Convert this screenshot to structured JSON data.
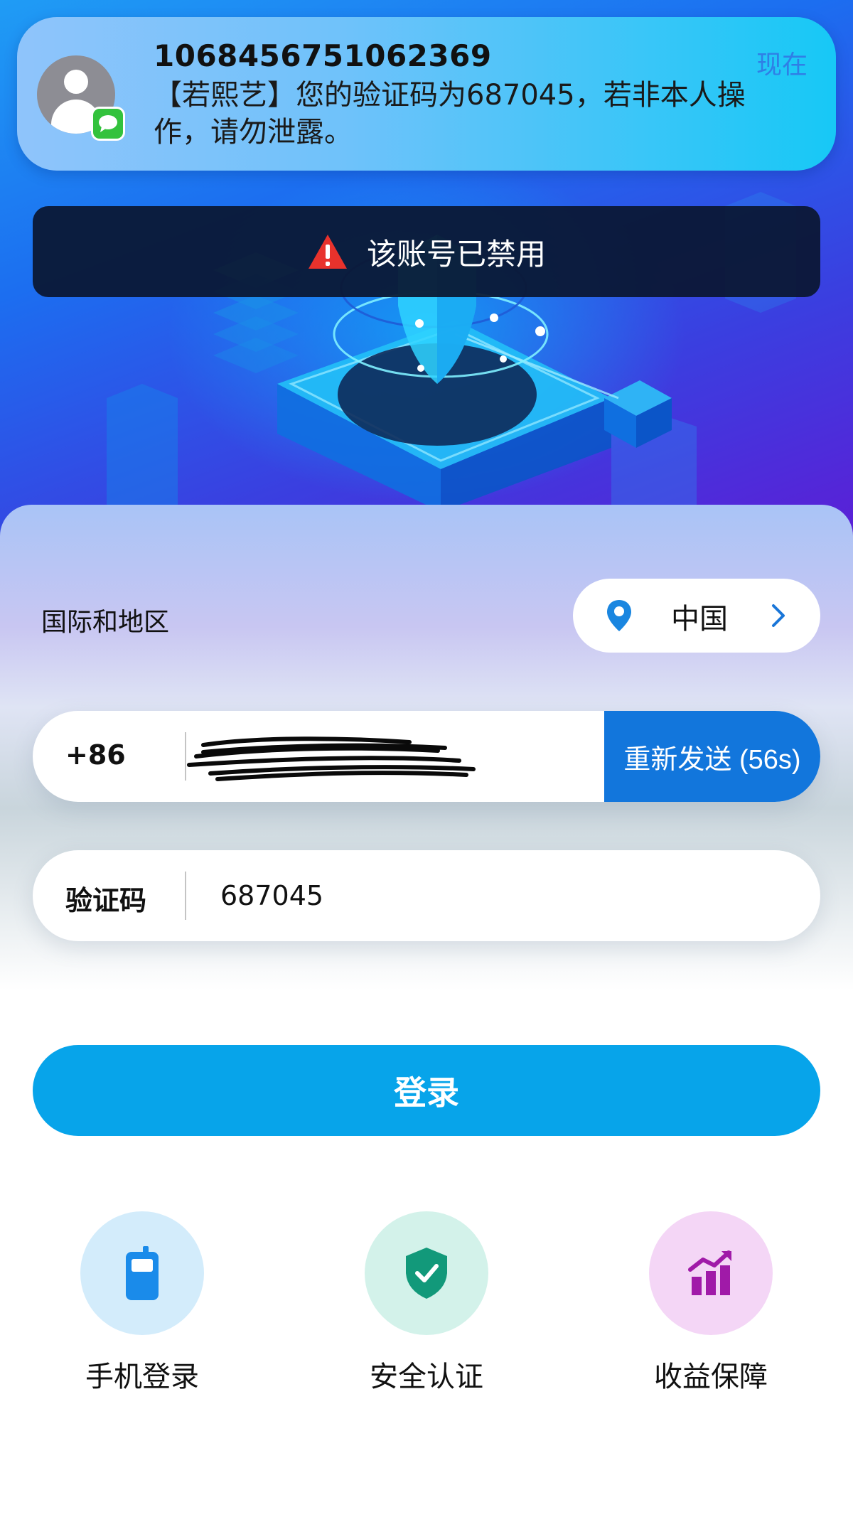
{
  "notification": {
    "sender": "1068456751062369",
    "time": "现在",
    "message": "【若熙艺】您的验证码为687045，若非本人操作，请勿泄露。"
  },
  "toast": {
    "icon": "warning-icon",
    "text": "该账号已禁用"
  },
  "region": {
    "label": "国际和地区",
    "value": "中国",
    "icon": "location-pin-icon"
  },
  "phone": {
    "prefix": "+86",
    "resend_label": "重新发送 (56s)"
  },
  "code": {
    "label": "验证码",
    "value": "687045"
  },
  "login": {
    "label": "登录"
  },
  "features": [
    {
      "label": "手机登录",
      "icon": "phone-icon",
      "color": "#1a8bea"
    },
    {
      "label": "安全认证",
      "icon": "shield-check-icon",
      "color": "#12997a"
    },
    {
      "label": "收益保障",
      "icon": "bar-chart-up-icon",
      "color": "#a01aa8"
    }
  ],
  "colors": {
    "primary_button": "#07a4ea",
    "resend_button": "#1276dc",
    "toast_bg": "#0a1630"
  }
}
